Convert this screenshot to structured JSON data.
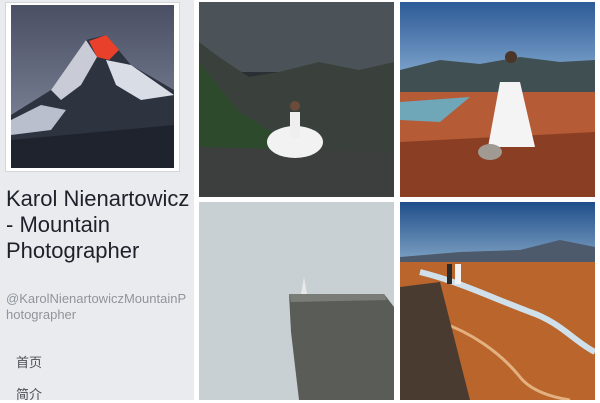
{
  "page": {
    "name": "Karol Nienartowicz - Mountain Photographer",
    "handle": "@KarolNienartowiczMountainPhotographer"
  },
  "nav": {
    "items": [
      {
        "label": "首页"
      },
      {
        "label": "简介"
      }
    ]
  },
  "photos": {
    "items": [
      {
        "subject": "mountain-peak-sunrise"
      },
      {
        "subject": "bride-on-cliff-storm"
      },
      {
        "subject": "bride-with-dog-valley"
      },
      {
        "subject": "figure-on-rock-ledge-fog"
      },
      {
        "subject": "couple-on-ridge-river-valley"
      }
    ]
  }
}
